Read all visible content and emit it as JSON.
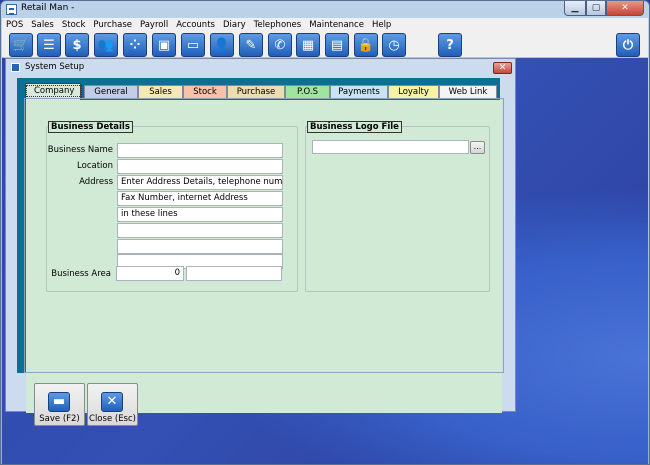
{
  "window": {
    "title": "Retail Man -"
  },
  "menu": [
    "POS",
    "Sales",
    "Stock",
    "Purchase",
    "Payroll",
    "Accounts",
    "Diary",
    "Telephones",
    "Maintenance",
    "Help"
  ],
  "toolbar": {
    "icons": [
      "cart-icon",
      "document-icon",
      "dollar-icon",
      "users-icon",
      "grid-icon",
      "box-icon",
      "card-icon",
      "user-icon",
      "edit-icon",
      "phone-icon",
      "table-icon",
      "calculator-icon",
      "lock-icon",
      "clock-icon",
      "help-icon",
      "power-icon"
    ],
    "help_label": "?"
  },
  "dialog": {
    "title": "System Setup",
    "close_label": "✕",
    "tabs": [
      {
        "label": "Company",
        "color": "#d8ead9",
        "active": true
      },
      {
        "label": "General",
        "color": "#c4cde8"
      },
      {
        "label": "Sales",
        "color": "#f6e7b6"
      },
      {
        "label": "Stock",
        "color": "#f7c2a8"
      },
      {
        "label": "Purchase",
        "color": "#ecdcb0"
      },
      {
        "label": "P.O.S",
        "color": "#9fe49f"
      },
      {
        "label": "Payments",
        "color": "#c8e3f1"
      },
      {
        "label": "Loyalty",
        "color": "#f7f3a2"
      },
      {
        "label": "Web Link",
        "color": "#f4f4f4"
      }
    ],
    "business_details": {
      "group_label": "Business Details",
      "name_label": "Business Name",
      "location_label": "Location",
      "address_label": "Address",
      "address_lines": [
        "Enter Address Details, telephone number,",
        "Fax Number, internet Address",
        "in these lines",
        "",
        "",
        ""
      ],
      "area_label": "Business Area",
      "area_value": "0",
      "area_text": ""
    },
    "logo": {
      "group_label": "Business Logo File",
      "value": "",
      "browse_label": "..."
    },
    "buttons": {
      "save_label": "Save (F2)",
      "close_label": "Close (Esc)"
    }
  }
}
